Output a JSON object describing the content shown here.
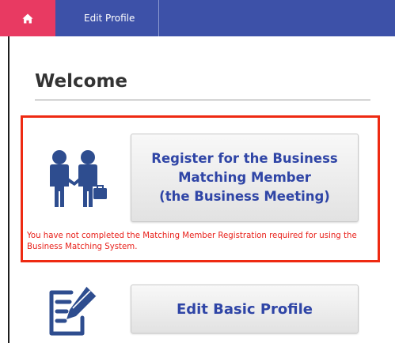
{
  "navbar": {
    "home_icon": "home-icon",
    "tab_label": "Edit Profile",
    "colors": {
      "bar": "#3d51a8",
      "home": "#e83a62"
    }
  },
  "page": {
    "title": "Welcome"
  },
  "matching": {
    "icon": "business-people-icon",
    "button_lines": [
      "Register for the Business",
      "Matching Member",
      "(the Business Meeting)"
    ],
    "warning": "You have not completed the Matching Member Registration required for using the Business Matching System.",
    "warning_color": "#e8201a",
    "highlight_color": "#ee2a12"
  },
  "basic_profile": {
    "icon": "edit-document-icon",
    "button_label": "Edit Basic Profile"
  }
}
